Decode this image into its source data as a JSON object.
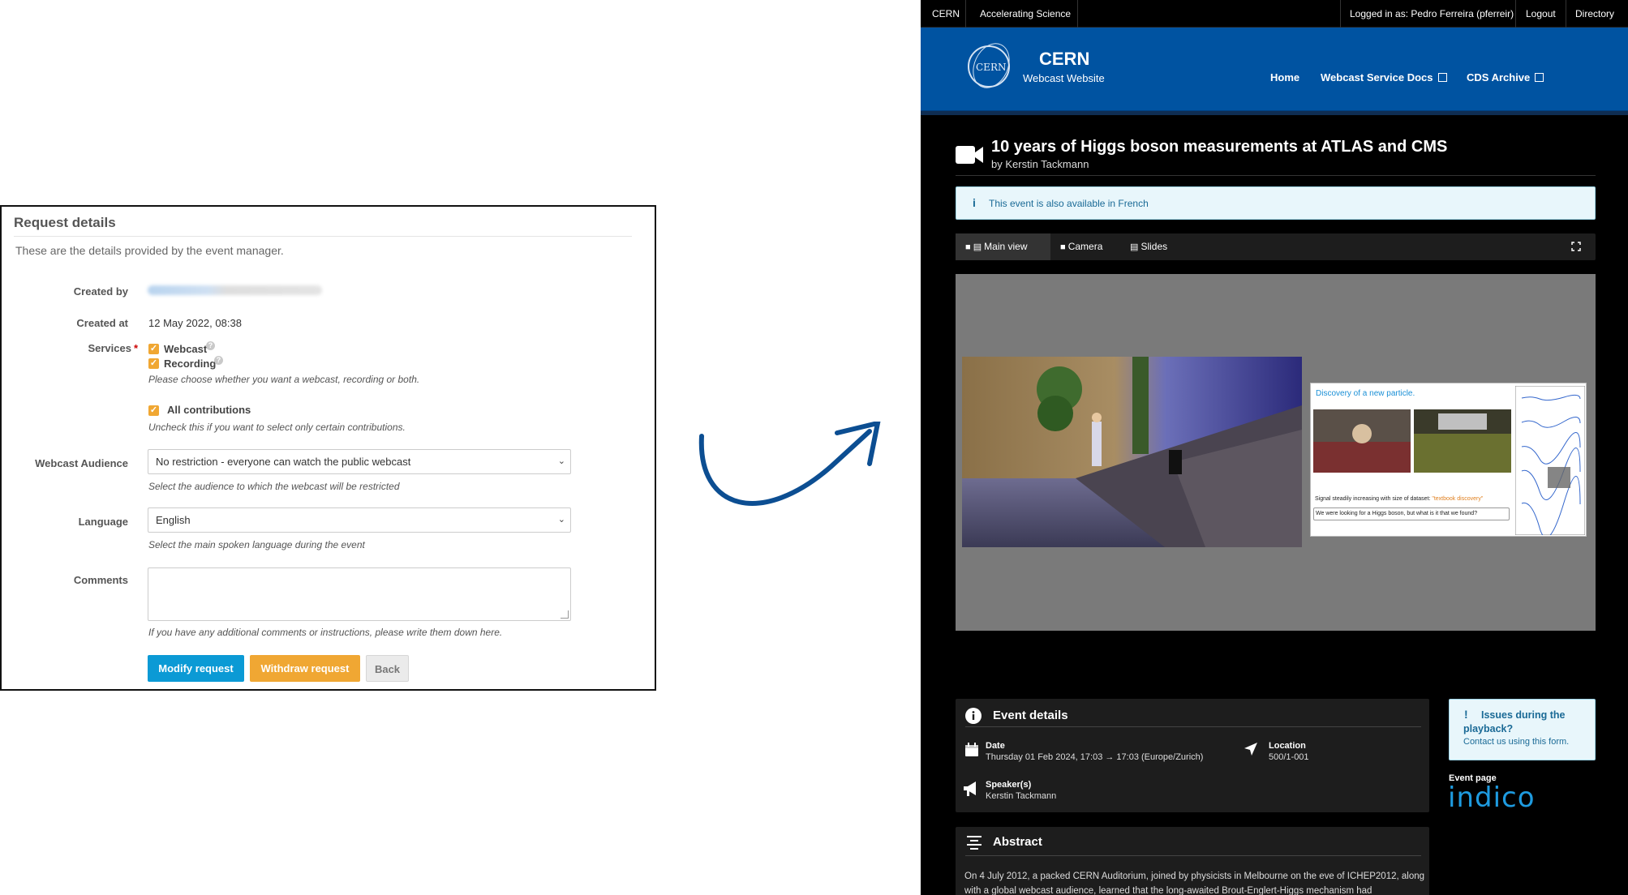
{
  "request_form": {
    "title": "Request details",
    "description": "These are the details provided by the event manager.",
    "created_by_label": "Created by",
    "created_at_label": "Created at",
    "created_at_value": "12 May 2022, 08:38",
    "services_label": "Services",
    "required_mark": "*",
    "webcast_label": "Webcast",
    "recording_label": "Recording",
    "services_hint": "Please choose whether you want a webcast, recording or both.",
    "all_contributions_label": "All contributions",
    "all_contributions_hint": "Uncheck this if you want to select only certain contributions.",
    "audience_label": "Webcast Audience",
    "audience_value": "No restriction - everyone can watch the public webcast",
    "audience_hint": "Select the audience to which the webcast will be restricted",
    "language_label": "Language",
    "language_value": "English",
    "language_hint": "Select the main spoken language during the event",
    "comments_label": "Comments",
    "comments_hint": "If you have any additional comments or instructions, please write them down here.",
    "modify_button": "Modify request",
    "withdraw_button": "Withdraw request",
    "back_button": "Back",
    "checkbox_states": {
      "webcast": true,
      "recording": true,
      "all_contributions": true
    }
  },
  "webcast_site": {
    "topbar": {
      "cern": "CERN",
      "accelerating": "Accelerating Science",
      "logged_in": "Logged in as: Pedro Ferreira (pferreir)",
      "logout": "Logout",
      "directory": "Directory"
    },
    "header": {
      "logo_text": "CERN",
      "brand": "CERN",
      "brand_sub": "Webcast Website",
      "nav_home": "Home",
      "nav_docs": "Webcast Service Docs",
      "nav_cds": "CDS Archive"
    },
    "event": {
      "title": "10 years of Higgs boson measurements at ATLAS and CMS",
      "byline": "by Kerstin Tackmann",
      "alert": "This event is also available in French",
      "tab_main": "Main view",
      "tab_camera": "Camera",
      "tab_slides": "Slides"
    },
    "slide": {
      "heading": "Discovery of a new particle.",
      "line1_prefix": "Signal steadily increasing with size of dataset: ",
      "line1_highlight": "\"textbook discovery\"",
      "line2": "We were looking for a Higgs boson, but what is it that we found?"
    },
    "details": {
      "section_title": "Event details",
      "date_label": "Date",
      "date_value": "Thursday 01 Feb 2024, 17:03 → 17:03 (Europe/Zurich)",
      "location_label": "Location",
      "location_value": "500/1-001",
      "speaker_label": "Speaker(s)",
      "speaker_value": "Kerstin Tackmann"
    },
    "issues": {
      "exclamation": "!",
      "title": "Issues during the playback?",
      "link": "Contact us",
      "suffix": " using this form."
    },
    "event_page": {
      "label": "Event page",
      "logo_text": "indico"
    },
    "abstract": {
      "section_title": "Abstract",
      "text": "On 4 July 2012, a packed CERN Auditorium, joined by physicists in Melbourne on the eve of ICHEP2012, along with a global webcast audience, learned that the long-awaited Brout-Englert-Higgs mechanism had"
    }
  },
  "colors": {
    "accent_blue": "#0053a1",
    "button_blue": "#0b9ad5",
    "button_orange": "#f0a733",
    "arrow_blue": "#0c4e92"
  },
  "icons": [
    "camera-icon",
    "info-icon",
    "calendar-icon",
    "location-arrow-icon",
    "megaphone-icon",
    "abstract-icon",
    "external-link-icon",
    "fullscreen-icon",
    "help-icon",
    "chevron-down-icon",
    "curved-arrow-icon"
  ]
}
